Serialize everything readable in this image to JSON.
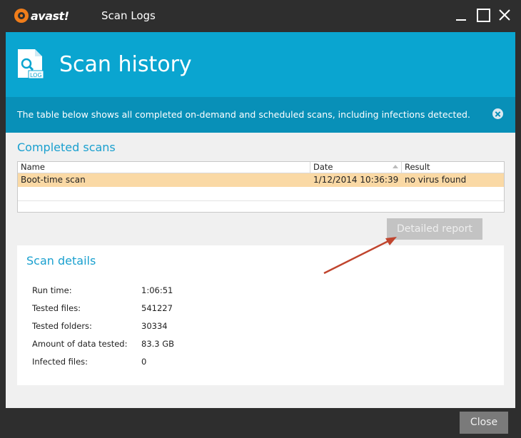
{
  "window": {
    "brand": "avast!",
    "title": "Scan Logs"
  },
  "header": {
    "icon_label": "LOG",
    "title": "Scan history"
  },
  "info": {
    "text": "The table below shows all completed on-demand and scheduled scans, including infections detected."
  },
  "completed": {
    "title": "Completed scans",
    "columns": [
      "Name",
      "Date",
      "Result"
    ],
    "rows": [
      {
        "name": "Boot-time scan",
        "date": "1/12/2014 10:36:39 ...",
        "result": "no virus found"
      }
    ]
  },
  "actions": {
    "detailed_report": "Detailed report",
    "close": "Close"
  },
  "details": {
    "title": "Scan details",
    "items": [
      {
        "label": "Run time:",
        "value": "1:06:51"
      },
      {
        "label": "Tested files:",
        "value": "541227"
      },
      {
        "label": "Tested folders:",
        "value": "30334"
      },
      {
        "label": "Amount of data tested:",
        "value": "83.3 GB"
      },
      {
        "label": "Infected files:",
        "value": "0"
      }
    ]
  },
  "colors": {
    "accent": "#0aa5d0",
    "info_bar": "#0890b8",
    "brand_orange": "#f07d1a",
    "selected_row": "#fad9a5",
    "annotation_arrow": "#c0452e"
  }
}
